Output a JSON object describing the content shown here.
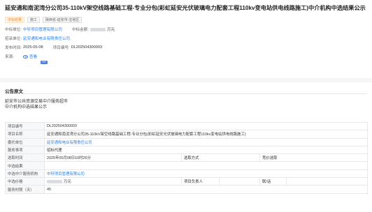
{
  "header": {
    "title": "延安通和南泥湾分公司35-110kV架空线路基础工程-专业分包(彩虹延安光伏玻璃电力配套工程110kv变电站供电线路施工)中介机构中选结果公示",
    "tags": [
      {
        "label": "中标结果",
        "style": "orange"
      },
      {
        "label": "施工",
        "style": "grey"
      },
      {
        "label": "陕西省-延安市-宝塔区",
        "style": "grey"
      }
    ],
    "winner_label": "中标单位:",
    "winner_value": "中轩项目管理有限公司",
    "amount_label": "中标金额:",
    "amount_suffix": "万元",
    "tenderer_label": "招采单位:",
    "tenderer_value": "延安通和电业有限责任公司",
    "pubtime_label": "发布时间:",
    "pubtime_value": "2025-05-08",
    "projno_label": "项目编号:",
    "projno_value": "DL202504300003",
    "source_label": "来源:",
    "view_label": "查看",
    "vip_label": "VIP"
  },
  "notice": {
    "section_title": "公告原文",
    "doc_org": "延安市公共资源交易中介服务超市",
    "doc_title": "中介机构中选结果公示"
  },
  "table": {
    "rows": [
      {
        "label": "项目编号",
        "value": "DL202504300003",
        "type": "plain"
      },
      {
        "label": "项目名称",
        "value": "延安通和南泥湾分公司35-110kV架空线路基础工程-专业分包(彩虹延安光伏玻璃电力配套工程110kv变电站供电线路施工)",
        "type": "plain"
      },
      {
        "label": "委托单位",
        "value": "延安通和电业有限责任公司",
        "type": "link"
      },
      {
        "label": "服务事项",
        "value": "招标代理",
        "type": "plain"
      },
      {
        "label": "选取时间",
        "value": "2025年05月08日10时26分",
        "type": "split",
        "sub_label": "选取方式",
        "sub_value": "竞价选取"
      },
      {
        "label": "中选结果",
        "value": "",
        "type": "plain"
      },
      {
        "label": "中选中介服务机构",
        "value": "中轩项目管理有限公司",
        "type": "link"
      },
      {
        "label": "中选价格",
        "value": "万元",
        "type": "split3",
        "sub_label": "项目负责人",
        "sub_value": "",
        "sub_label2": "联/话",
        "sub_value2": ""
      },
      {
        "label": "服务时限（天）",
        "value": "45",
        "type": "plain"
      }
    ]
  },
  "colors": {
    "link": "#2a7ee8",
    "tag_orange": "#f08a24",
    "vip": "#4a7fe8"
  }
}
